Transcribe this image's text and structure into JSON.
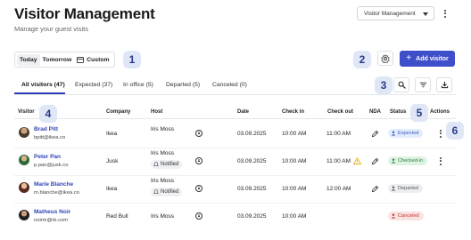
{
  "header": {
    "title": "Visitor Management",
    "subtitle": "Manage your guest visits",
    "module_select": "Visitor Management"
  },
  "date_filter": {
    "options": [
      "Today",
      "Tomorrow",
      "Custom"
    ],
    "selected": "Today"
  },
  "callouts": [
    "1",
    "2",
    "3",
    "4",
    "5",
    "6"
  ],
  "toolbar": {
    "add_label": "Add visitor"
  },
  "tabs": [
    {
      "label": "All visitors (47)",
      "active": true
    },
    {
      "label": "Expected (37)",
      "active": false
    },
    {
      "label": "In office (5)",
      "active": false
    },
    {
      "label": "Departed (5)",
      "active": false
    },
    {
      "label": "Canceled (0)",
      "active": false
    }
  ],
  "columns": [
    "Visitor",
    "Company",
    "Host",
    "Date",
    "Check in",
    "Check out",
    "NDA",
    "Status",
    "Actions"
  ],
  "rows": [
    {
      "name": "Brad Pitt",
      "email": "bpitt@ikea.co",
      "company": "Ikea",
      "host": "Iris Moss",
      "host_notified": false,
      "date": "03.09.2025",
      "check_in": "10:00 AM",
      "check_out": "11:00 AM",
      "nda_warning": false,
      "status": "Expected"
    },
    {
      "name": "Peter Pan",
      "email": "p.pan@jusk.co",
      "company": "Jusk",
      "host": "Iris Moss",
      "host_notified": true,
      "notified_label": "Notified",
      "date": "03.09.2025",
      "check_in": "10:00 AM",
      "check_out": "11:00 AM",
      "nda_warning": true,
      "status": "Checked-in"
    },
    {
      "name": "Marie Blanche",
      "email": "m.blanche@ikea.co",
      "company": "Ikea",
      "host": "Iris Moss",
      "host_notified": true,
      "notified_label": "Notified",
      "date": "03.09.2025",
      "check_in": "10:00 AM",
      "check_out": "12:00 AM",
      "nda_warning": false,
      "status": "Departed"
    },
    {
      "name": "Matheus Noir",
      "email": "noirm@rb.com",
      "company": "Red Bull",
      "host": "Iris Moss",
      "host_notified": false,
      "date": "03.09.2025",
      "check_in": "10:00 AM",
      "check_out": "",
      "nda_warning": false,
      "status": "Canceled"
    }
  ],
  "colors": {
    "accent": "#3f4fc9",
    "callout_bg": "#dfe7f6",
    "callout_text": "#2b3a8c",
    "status_expected_bg": "#e3ecfb",
    "status_expected_text": "#3a5bbf",
    "status_checkedin_bg": "#def3e4",
    "status_checkedin_text": "#2f7d45",
    "status_departed_bg": "#eceef1",
    "status_departed_text": "#555555",
    "status_canceled_bg": "#fbe2e2",
    "status_canceled_text": "#c0392b",
    "warning": "#e6a700"
  },
  "icons": [
    "settings-icon",
    "search-icon",
    "filter-icon",
    "download-icon",
    "calendar-icon",
    "chat-icon",
    "pencil-icon",
    "warning-icon",
    "kebab-icon"
  ]
}
